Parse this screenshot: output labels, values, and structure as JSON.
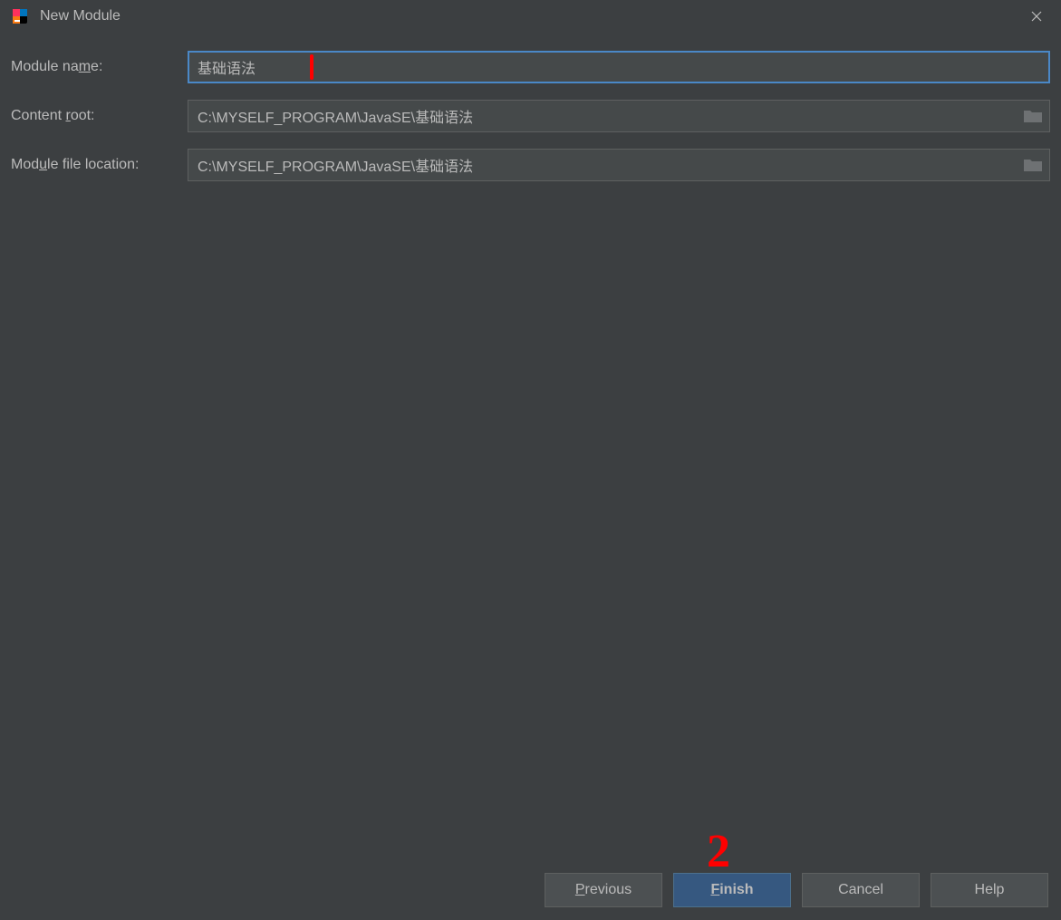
{
  "window": {
    "title": "New Module"
  },
  "form": {
    "module_name": {
      "label_pre": "Module na",
      "label_u": "m",
      "label_post": "e:",
      "value": "基础语法"
    },
    "content_root": {
      "label_pre": "Content ",
      "label_u": "r",
      "label_post": "oot:",
      "value": "C:\\MYSELF_PROGRAM\\JavaSE\\基础语法"
    },
    "module_file_location": {
      "label_pre": "Mod",
      "label_u": "u",
      "label_post": "le file location:",
      "value": "C:\\MYSELF_PROGRAM\\JavaSE\\基础语法"
    }
  },
  "buttons": {
    "previous": {
      "u": "P",
      "rest": "revious"
    },
    "finish": {
      "u": "F",
      "rest": "inish"
    },
    "cancel": {
      "label": "Cancel"
    },
    "help": {
      "label": "Help"
    }
  },
  "annotations": {
    "number": "2"
  }
}
